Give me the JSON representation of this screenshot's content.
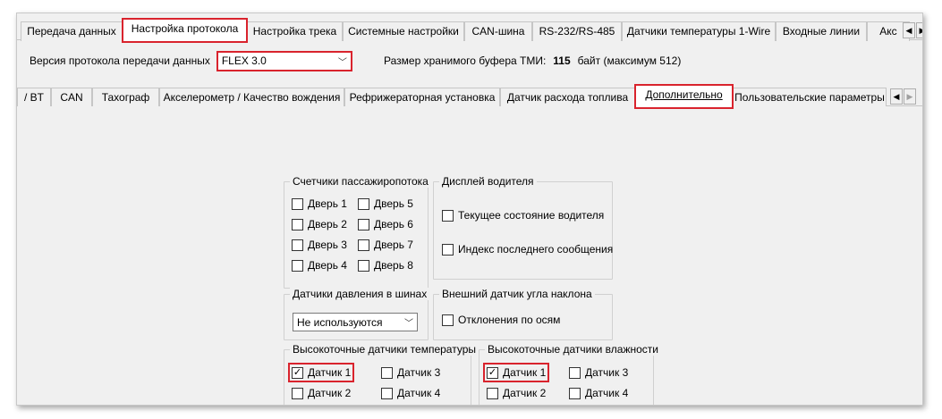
{
  "top_tabs": [
    {
      "label": "Передача данных"
    },
    {
      "label": "Настройка протокола",
      "active": true
    },
    {
      "label": "Настройка трека"
    },
    {
      "label": "Системные настройки"
    },
    {
      "label": "CAN-шина"
    },
    {
      "label": "RS-232/RS-485"
    },
    {
      "label": "Датчики температуры 1-Wire"
    },
    {
      "label": "Входные линии"
    },
    {
      "label": "Акс"
    }
  ],
  "protocol": {
    "label": "Версия протокола передачи данных",
    "value": "FLEX 3.0"
  },
  "buffer": {
    "label": "Размер хранимого буфера ТМИ:",
    "value": "115",
    "suffix": "байт (максимум 512)"
  },
  "inner_tabs": [
    {
      "label": "/ BT"
    },
    {
      "label": "CAN"
    },
    {
      "label": "Тахограф"
    },
    {
      "label": "Акселерометр / Качество вождения"
    },
    {
      "label": "Рефрижераторная установка"
    },
    {
      "label": "Датчик расхода топлива"
    },
    {
      "label": "Дополнительно",
      "active": true
    },
    {
      "label": "Пользовательские параметры"
    }
  ],
  "groups": {
    "passenger": {
      "title": "Счетчики пассажиропотока",
      "items": [
        {
          "label": "Дверь 1",
          "checked": false
        },
        {
          "label": "Дверь 2",
          "checked": false
        },
        {
          "label": "Дверь 3",
          "checked": false
        },
        {
          "label": "Дверь 4",
          "checked": false
        },
        {
          "label": "Дверь 5",
          "checked": false
        },
        {
          "label": "Дверь 6",
          "checked": false
        },
        {
          "label": "Дверь 7",
          "checked": false
        },
        {
          "label": "Дверь 8",
          "checked": false
        }
      ]
    },
    "driver_display": {
      "title": "Дисплей водителя",
      "items": [
        {
          "label": "Текущее состояние водителя",
          "checked": false
        },
        {
          "label": "Индекс последнего сообщения",
          "checked": false
        }
      ]
    },
    "tire_pressure": {
      "title": "Датчики давления в шинах",
      "value": "Не используются"
    },
    "tilt": {
      "title": "Внешний датчик угла наклона",
      "items": [
        {
          "label": "Отклонения по осям",
          "checked": false
        }
      ]
    },
    "hp_temp": {
      "title": "Высокоточные датчики температуры",
      "items": [
        {
          "label": "Датчик 1",
          "checked": true
        },
        {
          "label": "Датчик 2",
          "checked": false
        },
        {
          "label": "Датчик 3",
          "checked": false
        },
        {
          "label": "Датчик 4",
          "checked": false
        }
      ]
    },
    "hp_humidity": {
      "title": "Высокоточные датчики влажности",
      "items": [
        {
          "label": "Датчик 1",
          "checked": true
        },
        {
          "label": "Датчик 2",
          "checked": false
        },
        {
          "label": "Датчик 3",
          "checked": false
        },
        {
          "label": "Датчик 4",
          "checked": false
        }
      ]
    }
  },
  "colors": {
    "highlight": "#d9232d",
    "background": "#f0f0f0"
  }
}
